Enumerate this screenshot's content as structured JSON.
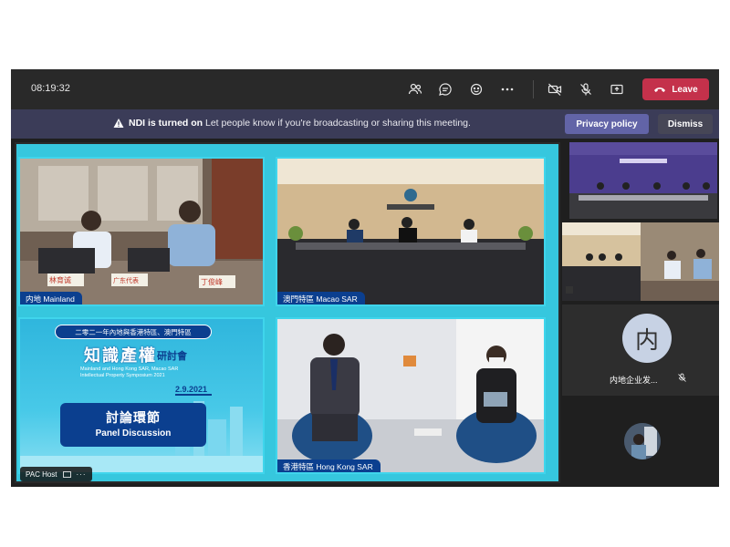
{
  "toolbar": {
    "clock": "08:19:32",
    "icons": [
      "people-icon",
      "chat-icon",
      "reactions-icon",
      "more-icon",
      "camera-off-icon",
      "mic-off-icon",
      "share-icon"
    ],
    "leave_label": "Leave"
  },
  "banner": {
    "title": "NDI is turned on",
    "message": "Let people know if you're broadcasting or sharing this meeting.",
    "privacy_label": "Privacy policy",
    "dismiss_label": "Dismiss"
  },
  "stage": {
    "q1_label": "内地 Mainland",
    "q1_nameplates": [
      "林育诚",
      "广东代表",
      "丁俊峰"
    ],
    "q2_label": "澳門特區 Macao SAR",
    "q4_label": "香港特區 Hong Kong SAR",
    "panel": {
      "header": "二零二一年內地與香港特區、澳門特區",
      "title_big": "知識產權",
      "title_small": "研討會",
      "english_1": "Mainland and Hong Kong SAR, Macao SAR",
      "english_2": "Intellectual Property Symposium 2021",
      "date": "2.9.2021",
      "session_zh": "討論環節",
      "session_en": "Panel Discussion"
    },
    "host_label": "PAC Host"
  },
  "participant": {
    "avatar_char": "内",
    "name": "内地企业发..."
  },
  "colors": {
    "leave": "#c4314b",
    "accent": "#6264a7",
    "stage_frame": "#36c7de"
  }
}
